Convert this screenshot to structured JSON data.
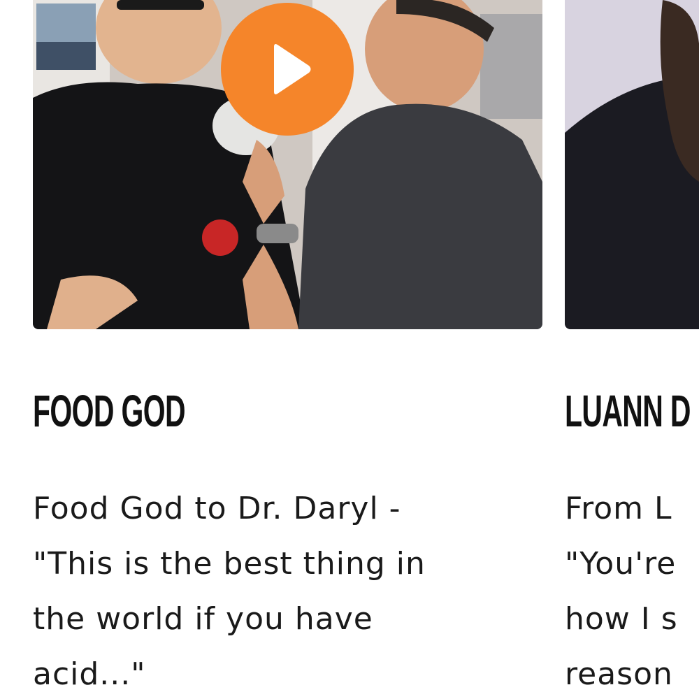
{
  "cards": [
    {
      "title": "FOOD GOD",
      "description": "Food God to Dr. Daryl -\n\"This is the best thing in\nthe world if you have\nacid...\"",
      "thumbnail_icon": "video-thumbnail",
      "play_icon": "play-icon"
    },
    {
      "title": "LUANN D",
      "description": "From L\n\"You're\nhow I s\nreason",
      "thumbnail_icon": "video-thumbnail",
      "play_icon": "play-icon"
    }
  ],
  "colors": {
    "play_button": "#f5852a",
    "play_triangle": "#ffffff",
    "title_text": "#111111",
    "body_text": "#1a1a1a",
    "background": "#ffffff"
  }
}
